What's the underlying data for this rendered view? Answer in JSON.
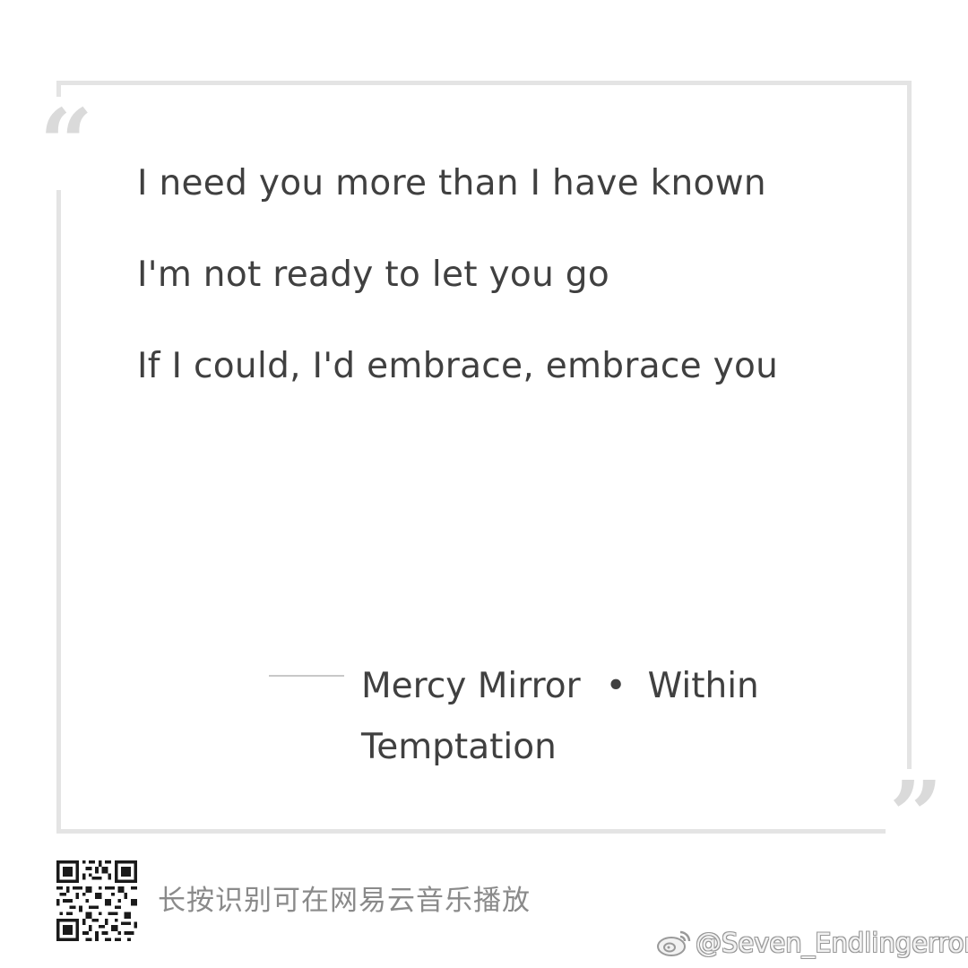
{
  "quote": {
    "open_mark": "“",
    "close_mark": "”"
  },
  "lyrics": [
    "I need you more than I have known",
    "I'm not ready to let you go",
    "If I could, I'd embrace, embrace you"
  ],
  "attribution": {
    "song": "Mercy Mirror",
    "separator": "•",
    "artist": "Within Temptation"
  },
  "footer": {
    "qr_icon": "qr-code-icon",
    "prompt": "长按识别可在网易云音乐播放"
  },
  "watermark": {
    "icon": "weibo-icon",
    "handle": "@Seven_Endlingerror"
  },
  "colors": {
    "frame": "#e4e4e4",
    "quote_marks": "#dadada",
    "text": "#404040",
    "footer_text": "#8a8a8a"
  }
}
